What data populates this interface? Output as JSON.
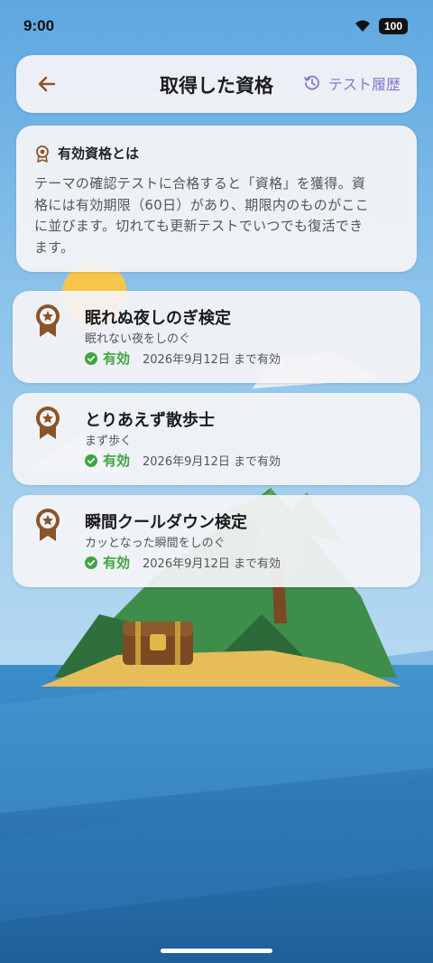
{
  "status_bar": {
    "time": "9:00",
    "battery": "100",
    "wifi_icon": "wifi-icon"
  },
  "header": {
    "title": "取得した資格",
    "history_label": "テスト履歴",
    "back_icon": "arrow-left-icon",
    "history_icon": "history-icon"
  },
  "info": {
    "title": "有効資格とは",
    "lines": [
      "テーマの確認テストに合格すると「資格」を獲得。資",
      "格には有効期限（60日）があり、期限内のものがここ",
      "に並びます。切れても更新テストでいつでも復活でき",
      "ます。"
    ]
  },
  "certificates": [
    {
      "name": "眠れぬ夜しのぎ検定",
      "subtitle": "眠れない夜をしのぐ",
      "status": "有効",
      "valid_until": "2026年9月12日 まで有効"
    },
    {
      "name": "とりあえず散歩士",
      "subtitle": "まず歩く",
      "status": "有効",
      "valid_until": "2026年9月12日 まで有効"
    },
    {
      "name": "瞬間クールダウン検定",
      "subtitle": "カッとなった瞬間をしのぐ",
      "status": "有効",
      "valid_until": "2026年9月12日 まで有効"
    }
  ],
  "colors": {
    "accent": "#7e7bc4",
    "badge": "#8b5428",
    "valid": "#3fa53f",
    "sky": "#8fc3e8",
    "sea": "#2b78b4"
  }
}
